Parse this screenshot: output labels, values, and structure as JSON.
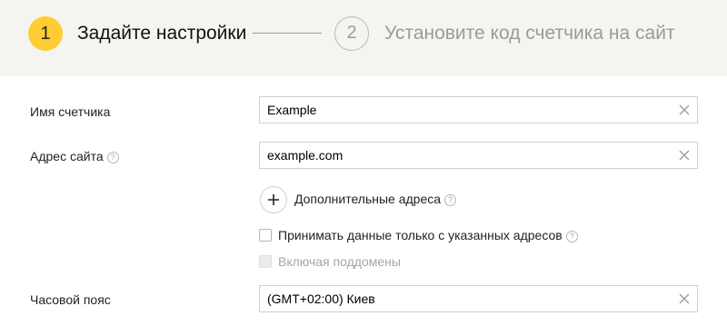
{
  "stepper": {
    "step1": {
      "number": "1",
      "label": "Задайте настройки"
    },
    "step2": {
      "number": "2",
      "label": "Установите код счетчика на сайт"
    }
  },
  "form": {
    "counter_name": {
      "label": "Имя счетчика",
      "value": "Example"
    },
    "site_address": {
      "label": "Адрес сайта",
      "value": "example.com",
      "help": "?"
    },
    "additional_addresses": {
      "label": "Дополнительные адреса",
      "help": "?"
    },
    "accept_only_specified": {
      "label": "Принимать данные только с указанных адресов",
      "help": "?",
      "checked": false
    },
    "include_subdomains": {
      "label": "Включая поддомены",
      "checked": false,
      "disabled": true
    },
    "timezone": {
      "label": "Часовой пояс",
      "value": "(GMT+02:00) Киев"
    }
  },
  "colors": {
    "active_step": "#ffcc33",
    "stepper_bg": "#f5f4f1",
    "field_border": "#cfcfcf"
  },
  "icons": {
    "clear": "close-icon",
    "add": "plus-icon",
    "help": "question-icon"
  }
}
